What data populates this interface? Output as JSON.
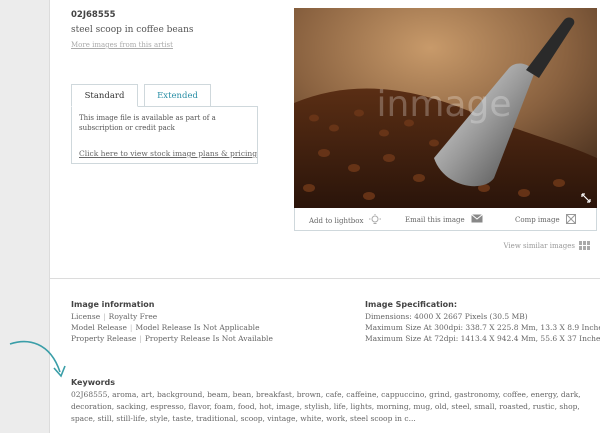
{
  "image": {
    "id": "02J68555",
    "title": "steel scoop in coffee beans",
    "more_link": "More images from this artist",
    "watermark": "inmage"
  },
  "license_tabs": {
    "tabs": [
      "Standard",
      "Extended"
    ],
    "active": "Standard",
    "panel_text": "This image file is available as part of a subscription or credit pack",
    "panel_link": "Click here to view stock image plans & pricing"
  },
  "actions": {
    "lightbox": "Add to lightbox",
    "email": "Email this image",
    "comp": "Comp image",
    "similar": "View similar images"
  },
  "image_information": {
    "title": "Image information",
    "rows": [
      [
        "License",
        "Royalty Free"
      ],
      [
        "Model Release",
        "Model Release Is Not Applicable"
      ],
      [
        "Property Release",
        "Property Release Is Not Available"
      ]
    ]
  },
  "image_specification": {
    "title": "Image Specification:",
    "rows": [
      "Dimensions: 4000 X 2667 Pixels (30.5 MB)",
      "Maximum Size At 300dpi: 338.7 X 225.8 Mm, 13.3 X 8.9 Inches",
      "Maximum Size At 72dpi: 1413.4 X 942.4 Mm, 55.6 X 37 Inches"
    ]
  },
  "keywords": {
    "title": "Keywords",
    "text": "02J68555, aroma, art, background, beam, bean, breakfast, brown, cafe, caffeine, cappuccino, grind, gastronomy, coffee, energy, dark, decoration, sacking, espresso, flavor, foam, food, hot, image, stylish, life, lights, morning, mug, old, steel, small, roasted, rustic, shop, space, still, still-life, style, taste, traditional, scoop, vintage, white, work, steel scoop in c..."
  },
  "colors": {
    "tab_accent": "#2a8fa6",
    "arrow": "#3a9ea8"
  }
}
